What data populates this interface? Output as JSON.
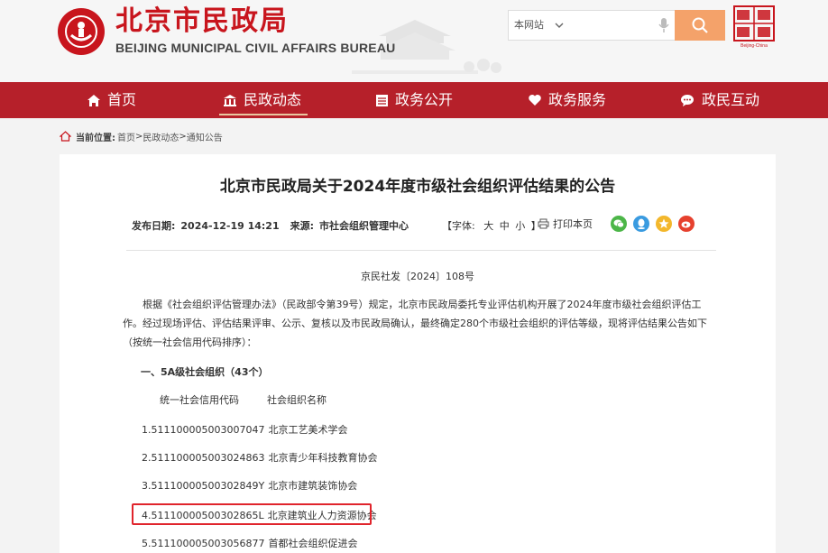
{
  "header": {
    "site_title_cn": "北京市民政局",
    "site_title_en": "BEIJING MUNICIPAL CIVIL AFFAIRS BUREAU",
    "search_scope": "本网站",
    "search_placeholder": "",
    "capital_logo_text": "Beijing-China"
  },
  "nav": {
    "items": [
      {
        "label": "首页",
        "icon": "home-icon"
      },
      {
        "label": "民政动态",
        "icon": "building-icon"
      },
      {
        "label": "政务公开",
        "icon": "document-icon"
      },
      {
        "label": "政务服务",
        "icon": "heart-icon"
      },
      {
        "label": "政民互动",
        "icon": "chat-icon"
      }
    ],
    "active_index": 1
  },
  "breadcrumb": {
    "label": "当前位置:",
    "items": [
      "首页",
      "民政动态",
      "通知公告"
    ],
    "separator": ">"
  },
  "article": {
    "title": "北京市民政局关于2024年度市级社会组织评估结果的公告",
    "date_label": "发布日期:",
    "date": "2024-12-19 14:21",
    "source_label": "来源:",
    "source": "市社会组织管理中心",
    "font_label": "【字体:",
    "font_large": "大",
    "font_medium": "中",
    "font_small": "小",
    "font_close": "】",
    "print_label": "打印本页",
    "doc_number": "京民社发〔2024〕108号",
    "paragraph": "根据《社会组织评估管理办法》（民政部令第39号）规定，北京市民政局委托专业评估机构开展了2024年度市级社会组织评估工作。经过现场评估、评估结果评审、公示、复核以及市民政局确认，最终确定280个市级社会组织的评估等级，现将评估结果公告如下（按统一社会信用代码排序）：",
    "section_title": "一、5A级社会组织（43个）",
    "col_code": "统一社会信用代码",
    "col_name": "社会组织名称",
    "rows": [
      {
        "code": "1.51110000500300704​7",
        "name": "北京工艺美术学会"
      },
      {
        "code": "2.511100005003024863",
        "name": "北京青少年科技教育协会"
      },
      {
        "code": "3.51110000500302849Y",
        "name": "北京市建筑装饰协会"
      },
      {
        "code": "4.51110000500302865L",
        "name": "北京建筑业人力资源协会"
      },
      {
        "code": "5.511100005003056877",
        "name": "首都社会组织促进会"
      }
    ]
  },
  "colors": {
    "brand_red": "#c8151d",
    "nav_red": "#b6202a",
    "search_orange": "#f4a26a",
    "highlight_red": "#e0242c"
  }
}
